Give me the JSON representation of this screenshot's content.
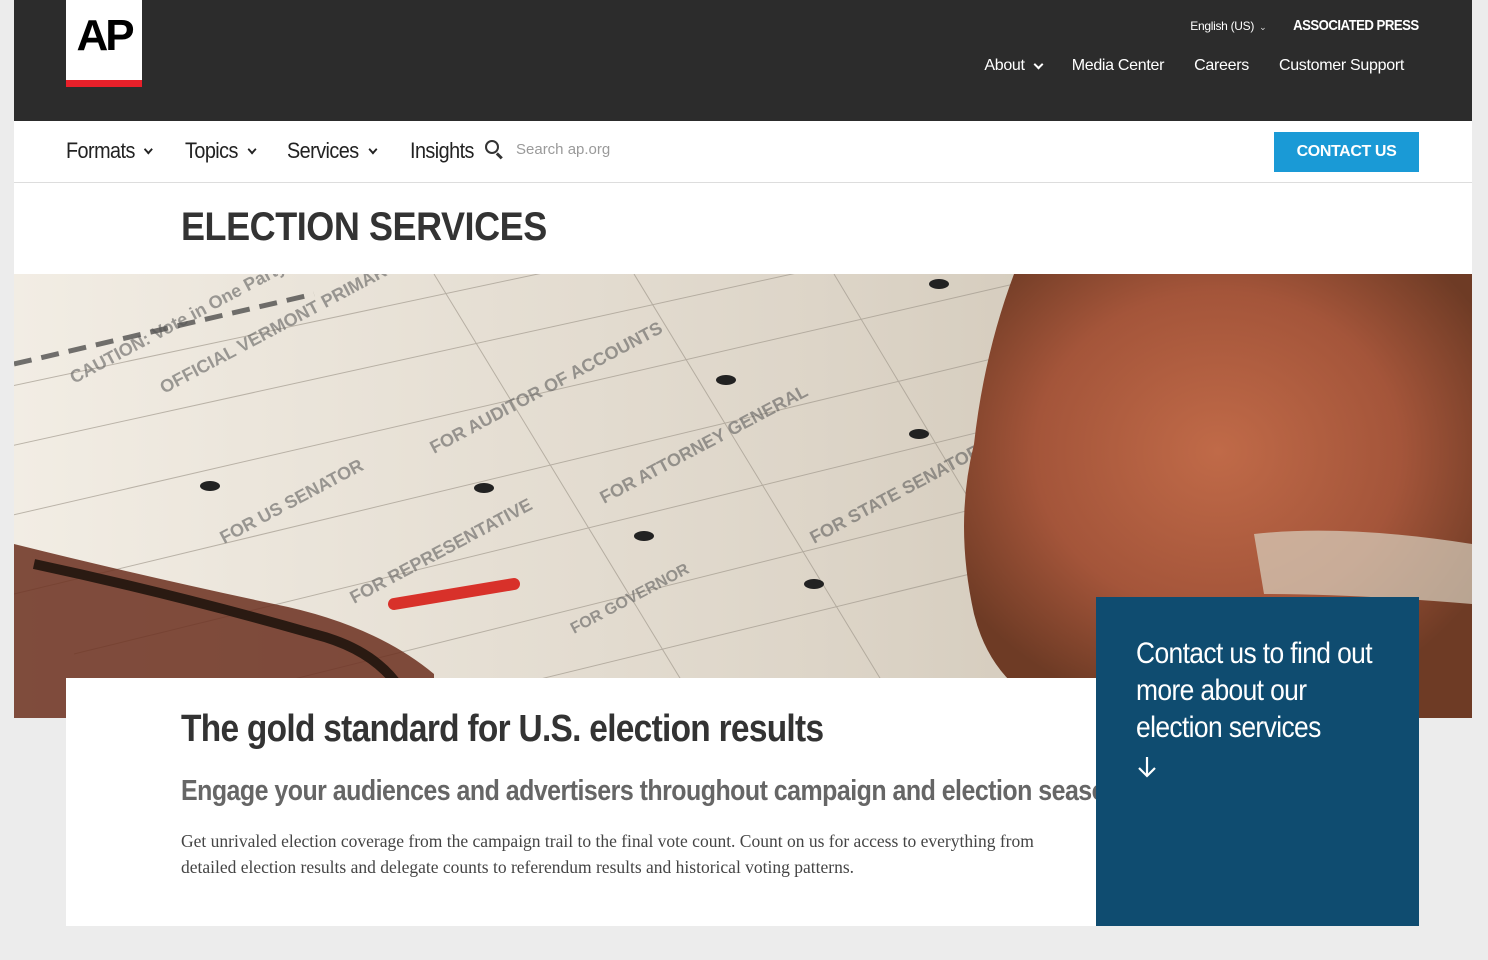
{
  "header": {
    "logo": {
      "text": "AP"
    },
    "language": "English (US)",
    "brand": "ASSOCIATED PRESS",
    "top_nav": [
      {
        "label": "About",
        "has_dropdown": true
      },
      {
        "label": "Media Center",
        "has_dropdown": false
      },
      {
        "label": "Careers",
        "has_dropdown": false
      },
      {
        "label": "Customer Support",
        "has_dropdown": false
      }
    ]
  },
  "main_nav": {
    "items": [
      {
        "label": "Formats",
        "has_dropdown": true
      },
      {
        "label": "Topics",
        "has_dropdown": true
      },
      {
        "label": "Services",
        "has_dropdown": true
      },
      {
        "label": "Insights",
        "has_dropdown": false
      }
    ],
    "search": {
      "placeholder": "Search ap.org",
      "value": "",
      "icon": "search-icon"
    },
    "contact_button": "CONTACT US"
  },
  "page": {
    "title": "ELECTION SERVICES"
  },
  "hero": {
    "image": "ballot-photo"
  },
  "content": {
    "heading": "The gold standard for U.S. election results",
    "subheading": "Engage your audiences and advertisers throughout campaign and election season",
    "body": "Get unrivaled election coverage from the campaign trail to the final vote count. Count on us for access to everything from detailed election results and delegate counts to referendum results and historical voting patterns."
  },
  "sidebox": {
    "text": "Contact us to find out more about our election services",
    "icon": "arrow-down-icon"
  },
  "colors": {
    "topbar": "#2c2c2c",
    "accent_blue": "#1a9ad6",
    "sidebox_blue": "#0f4c70",
    "logo_red": "#e8202a"
  }
}
